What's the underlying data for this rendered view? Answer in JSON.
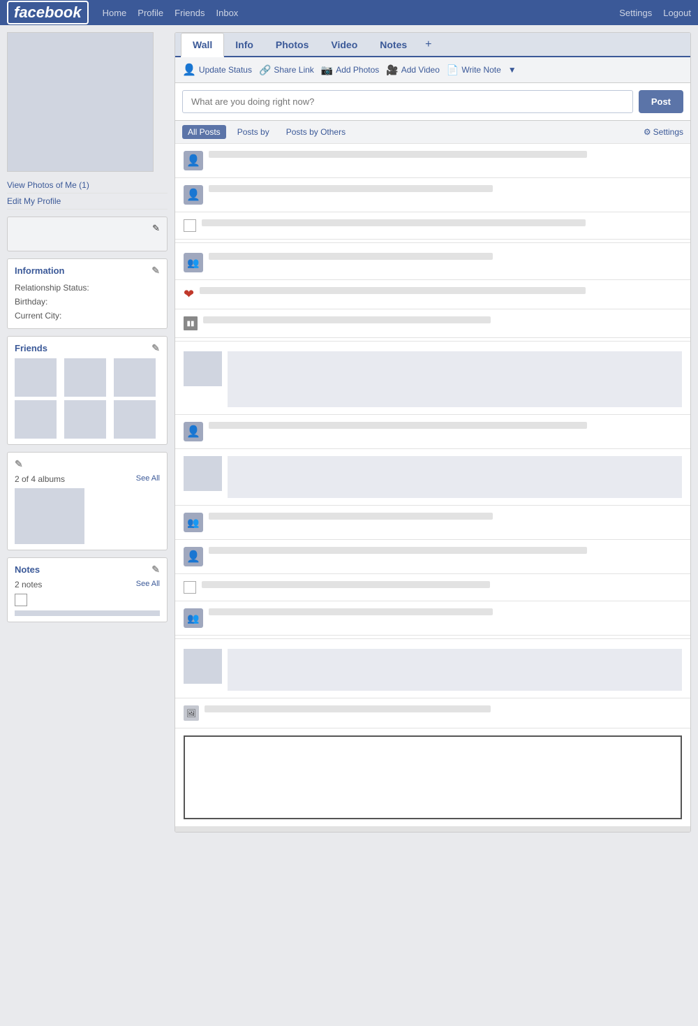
{
  "nav": {
    "logo": "facebook",
    "links": [
      "Home",
      "Profile",
      "Friends",
      "Inbox"
    ],
    "right_links": [
      "Settings",
      "Logout"
    ]
  },
  "profile": {
    "view_photos": "View Photos of Me (1)",
    "edit_profile": "Edit My Profile"
  },
  "bio": {
    "edit_icon": "✎"
  },
  "information": {
    "title": "Information",
    "edit_icon": "✎",
    "relationship_label": "Relationship Status:",
    "birthday_label": "Birthday:",
    "city_label": "Current City:"
  },
  "friends": {
    "title": "Friends",
    "edit_icon": "✎"
  },
  "albums": {
    "count": "2 of 4 albums",
    "see_all": "See All",
    "edit_icon": "✎"
  },
  "notes": {
    "title": "Notes",
    "edit_icon": "✎",
    "count": "2 notes",
    "see_all": "See All"
  },
  "tabs": {
    "items": [
      "Wall",
      "Info",
      "Photos",
      "Video",
      "Notes"
    ],
    "active": "Wall",
    "add_icon": "+"
  },
  "actions": {
    "update_status": "Update Status",
    "share_link": "Share Link",
    "add_photos": "Add Photos",
    "add_video": "Add Video",
    "write_note": "Write Note"
  },
  "status": {
    "placeholder": "What are you doing right now?",
    "post_button": "Post"
  },
  "filter": {
    "all_posts": "All Posts",
    "posts_by": "Posts by",
    "posts_by_others": "Posts by Others",
    "settings": "Settings"
  }
}
